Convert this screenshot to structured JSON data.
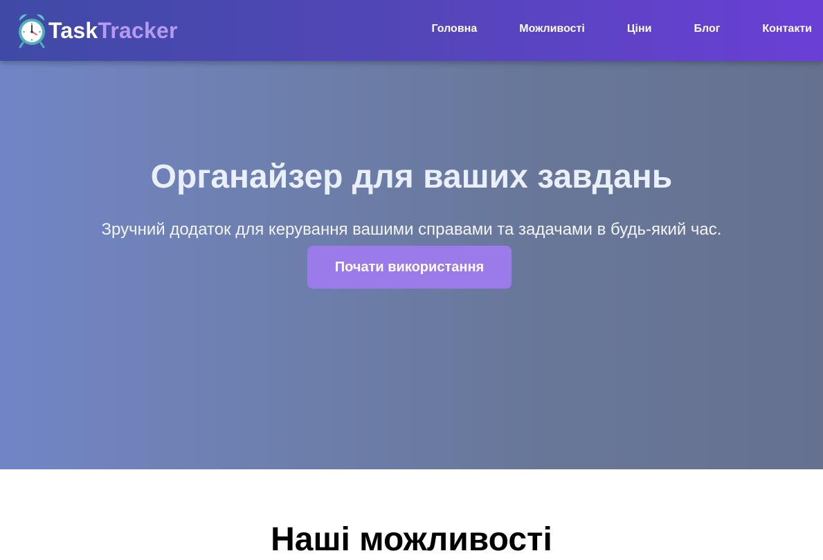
{
  "brand": {
    "name_part1": "Task",
    "name_part2": "Tracker",
    "icon": "alarm-clock-icon"
  },
  "nav": {
    "items": [
      {
        "label": "Головна"
      },
      {
        "label": "Можливості"
      },
      {
        "label": "Ціни"
      },
      {
        "label": "Блог"
      },
      {
        "label": "Контакти"
      }
    ]
  },
  "hero": {
    "title": "Органайзер для ваших завдань",
    "subtitle": "Зручний додаток для керування вашими справами та задачами в будь-який час.",
    "cta_label": "Почати використання"
  },
  "features": {
    "title": "Наші можливості"
  },
  "colors": {
    "nav_start": "#3f4aa6",
    "nav_end": "#6a3fd6",
    "accent": "#9b7be9",
    "hero_bg": "#6e7eb0"
  }
}
